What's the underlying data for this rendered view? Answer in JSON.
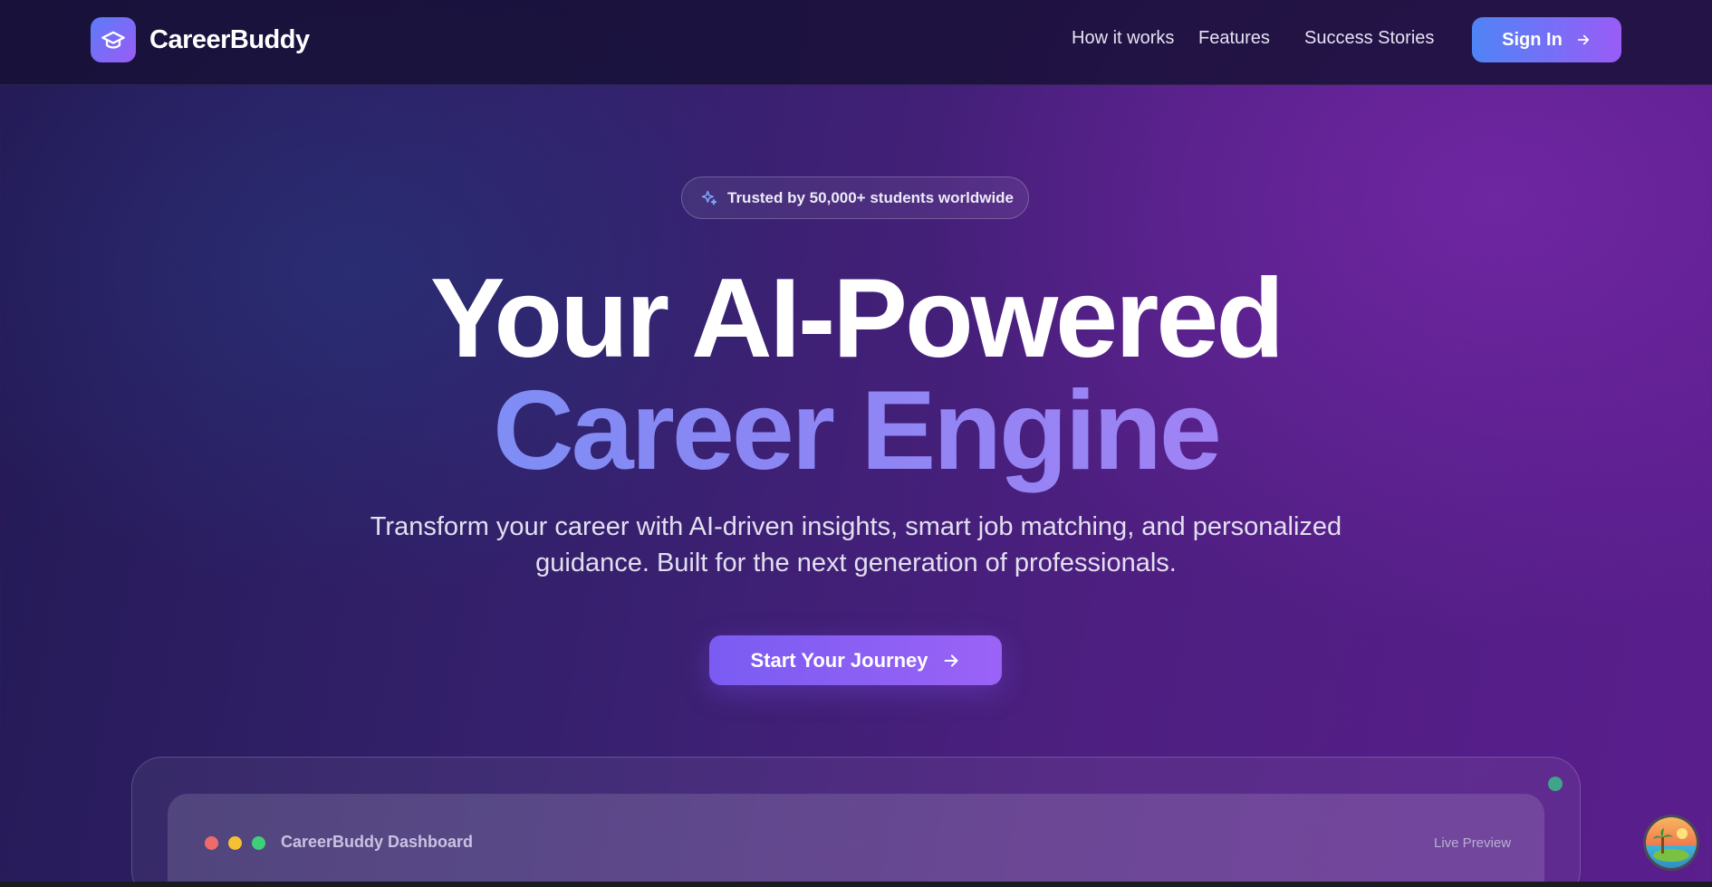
{
  "nav": {
    "brand": "CareerBuddy",
    "links": [
      "How it works",
      "Features",
      "Success Stories"
    ],
    "signin_label": "Sign In",
    "icons": {
      "logo": "graduation-cap-icon",
      "signin_arrow": "arrow-right-icon"
    }
  },
  "hero": {
    "badge": "Trusted by 50,000+ students worldwide",
    "badge_icon": "sparkles-icon",
    "title_line1": "Your AI-Powered",
    "title_line2": "Career Engine",
    "subtitle_line1": "Transform your career with AI-driven insights, smart job matching, and personalized",
    "subtitle_line2": "guidance. Built for the next generation of professionals.",
    "cta_label": "Start Your Journey"
  },
  "preview": {
    "title": "CareerBuddy Dashboard",
    "status": "Live Preview"
  },
  "colors": {
    "accent_blue": "#4f84f5",
    "accent_purple": "#9a5cf6",
    "gradient_text_start": "#6a9af7",
    "gradient_text_end": "#b57ff5"
  }
}
